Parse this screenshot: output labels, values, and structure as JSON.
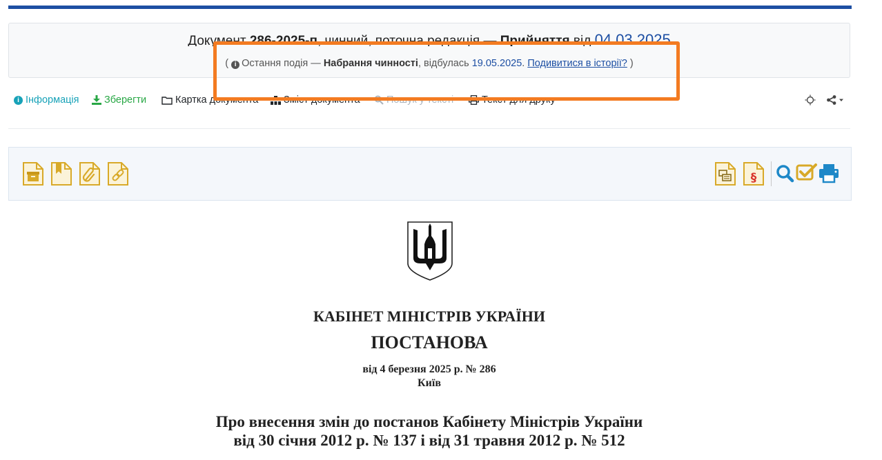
{
  "status": {
    "line1": {
      "prefix": "Документ",
      "doc_number": "286-2025-п",
      "middle": ", чинний, поточна редакція —",
      "event": "Прийняття",
      "from": "від",
      "date": "04.03.2025"
    },
    "line2": {
      "open": "(",
      "label": "Остання подія —",
      "event": "Набрання чинності",
      "mid": ", відбулась",
      "date": "19.05.2025",
      "dot": ".",
      "link": "Подивитися в історії?",
      "close": ")"
    }
  },
  "menu": {
    "info": "Інформація",
    "save": "Зберегти",
    "card": "Картка документа",
    "contents": "Зміст документа",
    "search": "Пошук у тексті",
    "print": "Текст для друку"
  },
  "document": {
    "authority": "КАБІНЕТ МІНІСТРІВ УКРАЇНИ",
    "type": "ПОСТАНОВА",
    "date_line": "від 4 березня 2025 р. № 286",
    "city": "Київ",
    "title_line1": "Про внесення змін до постанов Кабінету Міністрів України",
    "title_line2": "від 30 січня 2012 р. № 137 і від 31 травня 2012 р. № 512"
  },
  "colors": {
    "accent": "#1d4fa3",
    "highlight": "#f37b21",
    "info": "#17a2b8",
    "save": "#28a745",
    "toolbar_icon": "#d8a928"
  }
}
